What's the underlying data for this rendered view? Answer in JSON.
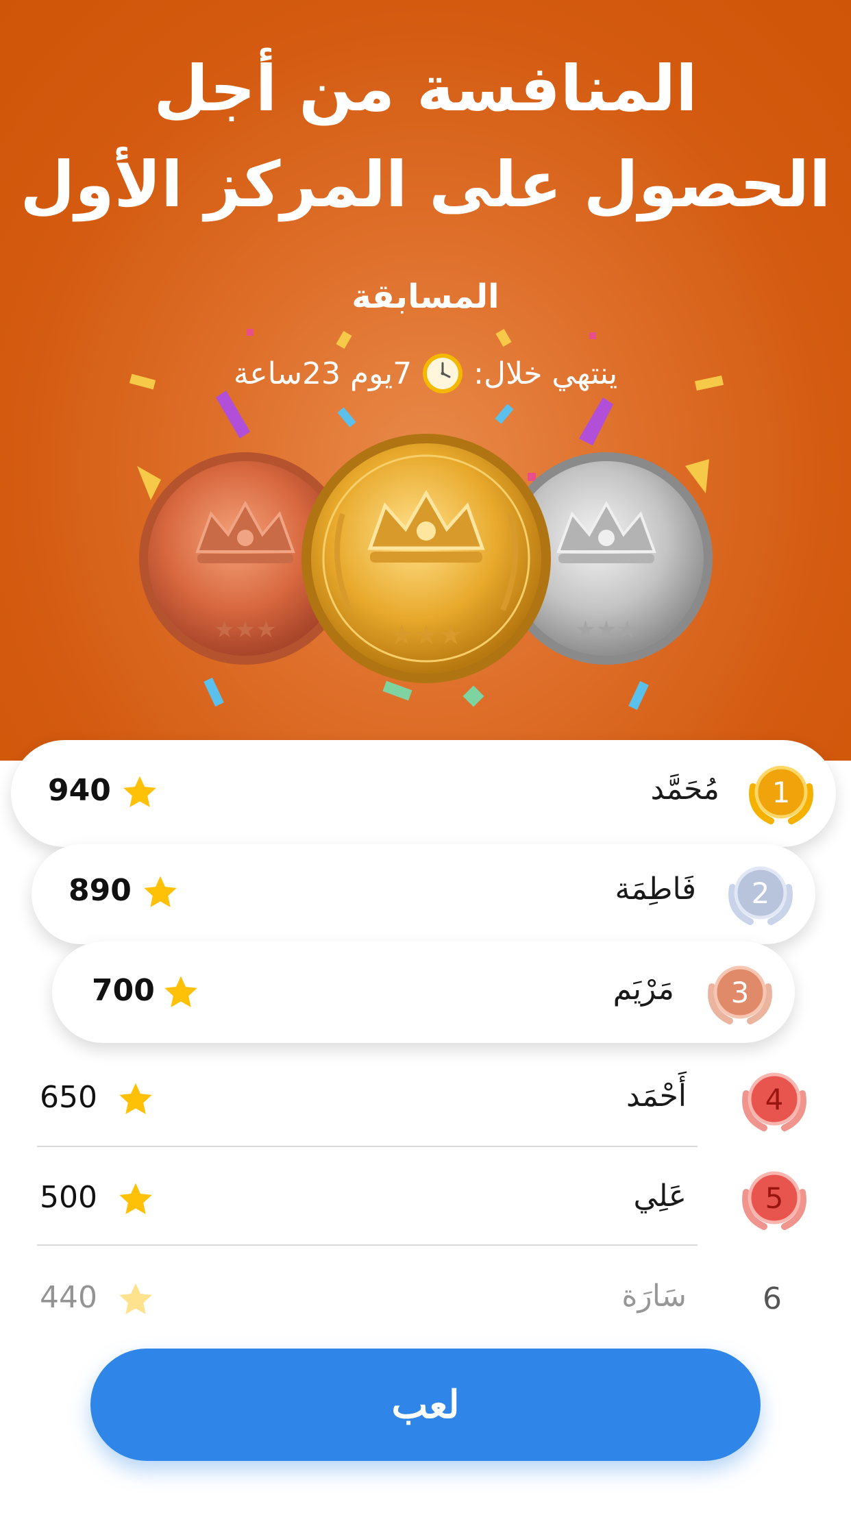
{
  "hero": {
    "headline_line1": "المنافسة من أجل",
    "headline_line2": "الحصول على المركز الأول",
    "subtitle": "المسابقة",
    "timer_prefix": "ينتهي خلال:",
    "timer_value": "7يوم 23ساعة",
    "clock_icon": "clock-icon"
  },
  "leaderboard": [
    {
      "rank": "1",
      "name": "مُحَمَّد",
      "score": "940"
    },
    {
      "rank": "2",
      "name": "فَاطِمَة",
      "score": "890"
    },
    {
      "rank": "3",
      "name": "مَرْيَم",
      "score": "700"
    },
    {
      "rank": "4",
      "name": "أَحْمَد",
      "score": "650"
    },
    {
      "rank": "5",
      "name": "عَلِي",
      "score": "500"
    },
    {
      "rank": "6",
      "name": "سَارَة",
      "score": "440"
    }
  ],
  "colors": {
    "hero_orange": "#d35a0f",
    "gold": "#f0a30a",
    "silver": "#b8c4dc",
    "bronze": "#e08a6a",
    "red_badge": "#e8554e",
    "star": "#ffc107",
    "button_blue": "#2f86e8"
  },
  "play_button": {
    "label": "لعب"
  }
}
